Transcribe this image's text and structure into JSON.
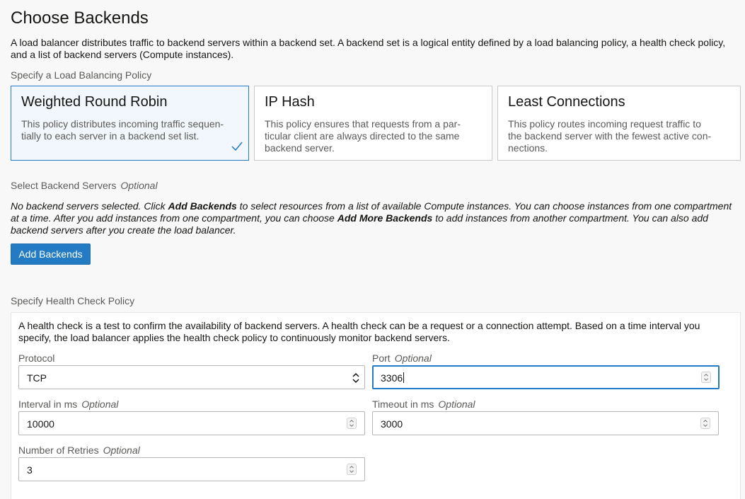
{
  "page": {
    "title": "Choose Backends",
    "intro": "A load balancer distributes traffic to backend servers within a backend set. A backend set is a logical entity defined by a load balancing policy, a health check policy, and a list of backend servers (Compute instances)."
  },
  "policy_section": {
    "label": "Specify a Load Balancing Policy",
    "selected": "Weighted Round Robin",
    "cards": [
      {
        "title": "Weighted Round Robin",
        "desc": "This policy distributes incoming traffic sequen-tially to each server in a backend set list."
      },
      {
        "title": "IP Hash",
        "desc": "This policy ensures that requests from a par-ticular client are always directed to the same backend server."
      },
      {
        "title": "Least Connections",
        "desc": "This policy routes incoming request traffic to the backend server with the fewest active con-nections."
      }
    ]
  },
  "backend_section": {
    "label": "Select Backend Servers",
    "optional": "Optional",
    "note_1": "No backend servers selected. Click ",
    "note_b1": "Add Backends",
    "note_2": " to select resources from a list of available Compute instances. You can choose instances from one compartment at a time. After you add instances from one compartment, you can choose ",
    "note_b2": "Add More Backends",
    "note_3": " to add instances from another compartment. You can also add backend servers after you create the load balancer.",
    "button": "Add Backends"
  },
  "health_check": {
    "label": "Specify Health Check Policy",
    "desc": "A health check is a test to confirm the availability of backend servers. A health check can be a request or a connection attempt. Based on a time interval you specify, the load balancer applies the health check policy to continuously monitor backend servers.",
    "protocol": {
      "label": "Protocol",
      "value": "TCP"
    },
    "port": {
      "label": "Port",
      "optional": "Optional",
      "value": "3306"
    },
    "interval": {
      "label": "Interval in ms",
      "optional": "Optional",
      "value": "10000"
    },
    "timeout": {
      "label": "Timeout in ms",
      "optional": "Optional",
      "value": "3000"
    },
    "retries": {
      "label": "Number of Retries",
      "optional": "Optional",
      "value": "3"
    }
  },
  "colors": {
    "accent": "#227bc3",
    "selected_bg": "#f1f7fd"
  },
  "icons": [
    "checkmark-icon",
    "select-arrows-icon",
    "spinner-icon"
  ]
}
